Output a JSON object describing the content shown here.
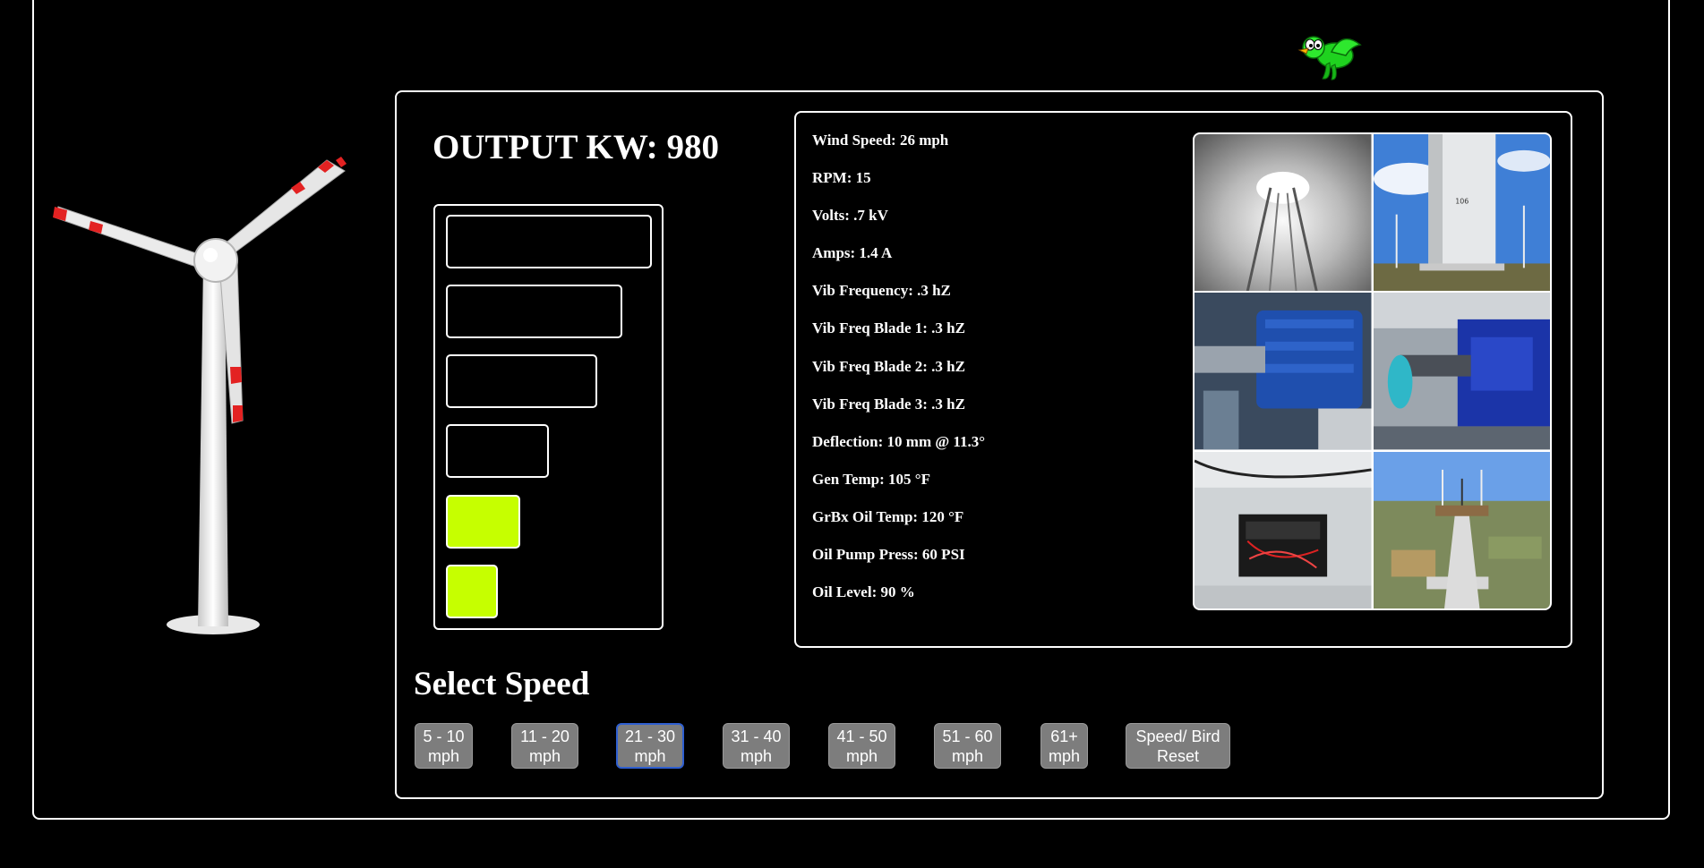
{
  "output": {
    "label": "OUTPUT KW: 980"
  },
  "meter": {
    "accent": "#c6ff00",
    "segments": [
      {
        "lit": false
      },
      {
        "lit": false
      },
      {
        "lit": false
      },
      {
        "lit": false
      },
      {
        "lit": true
      },
      {
        "lit": true
      }
    ]
  },
  "readings": [
    "Wind Speed: 26 mph",
    "RPM: 15",
    "Volts: .7 kV",
    "Amps: 1.4 A",
    "Vib Frequency: .3 hZ",
    "Vib Freq Blade 1: .3 hZ",
    "Vib Freq Blade 2: .3 hZ",
    "Vib Freq Blade 3: .3 hZ",
    "Deflection: 10 mm @ 11.3°",
    "Gen Temp: 105 °F",
    "GrBx Oil Temp: 120 °F",
    "Oil Pump Press: 60 PSI",
    "Oil Level: 90 %"
  ],
  "photos": [
    "tower-interior-photo",
    "tower-base-photo",
    "generator-photo",
    "gearbox-photo",
    "control-box-photo",
    "nacelle-top-view-photo"
  ],
  "select_speed": {
    "title": "Select Speed"
  },
  "speed_buttons": [
    {
      "line1": "5 - 10",
      "line2": "mph",
      "selected": false
    },
    {
      "line1": "11 - 20",
      "line2": "mph",
      "selected": false
    },
    {
      "line1": "21 - 30",
      "line2": "mph",
      "selected": true
    },
    {
      "line1": "31 - 40",
      "line2": "mph",
      "selected": false
    },
    {
      "line1": "41 - 50",
      "line2": "mph",
      "selected": false
    },
    {
      "line1": "51 - 60",
      "line2": "mph",
      "selected": false
    },
    {
      "line1": "61+",
      "line2": "mph",
      "selected": false
    },
    {
      "line1": "Speed/ Bird",
      "line2": "Reset",
      "selected": false
    }
  ],
  "icons": {
    "bird": "green-bird-icon",
    "turbine": "wind-turbine-icon"
  }
}
